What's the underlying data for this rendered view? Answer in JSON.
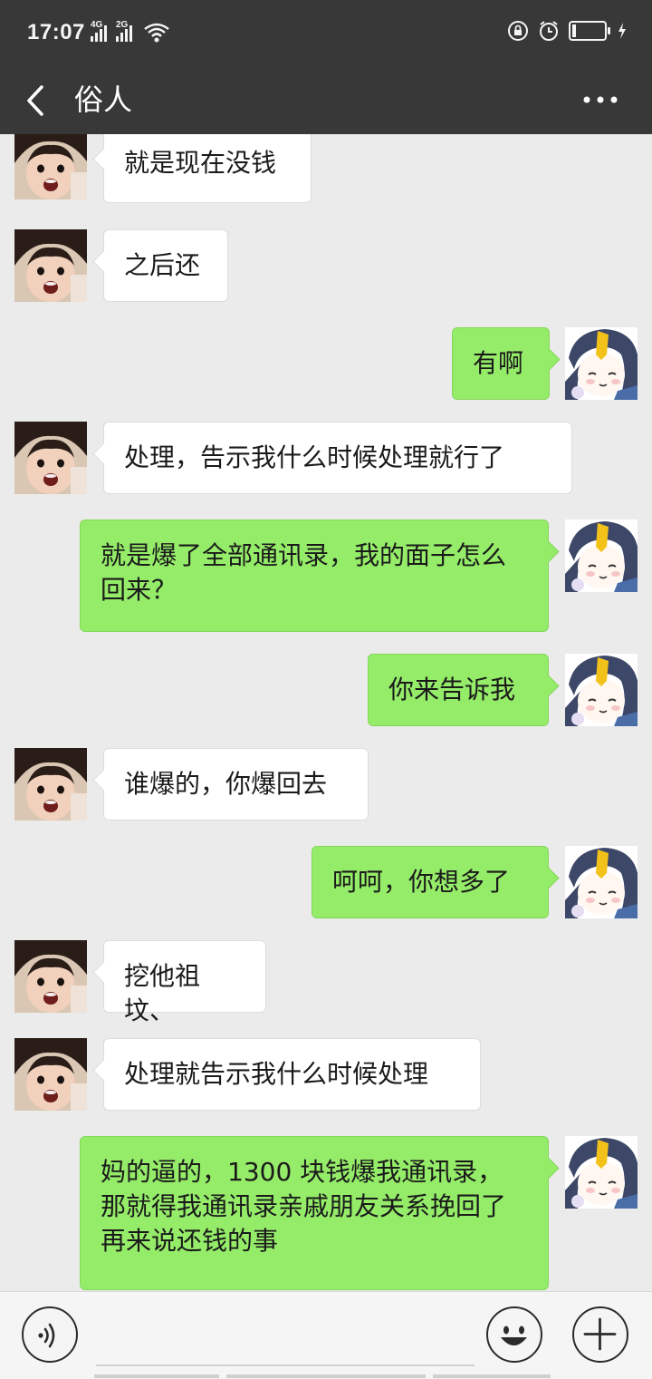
{
  "status_bar": {
    "time": "17:07",
    "net1": "4G",
    "net2": "2G"
  },
  "header": {
    "title": "俗人"
  },
  "messages": [
    {
      "side": "left",
      "text": "就是现在没钱"
    },
    {
      "side": "left",
      "text": "之后还"
    },
    {
      "side": "right",
      "text": "有啊"
    },
    {
      "side": "left",
      "text": "处理，告示我什么时候处理就行了"
    },
    {
      "side": "right",
      "text": "就是爆了全部通讯录，我的面子怎么回来？"
    },
    {
      "side": "right",
      "text": "你来告诉我"
    },
    {
      "side": "left",
      "text": "谁爆的，你爆回去"
    },
    {
      "side": "right",
      "text": "呵呵，你想多了"
    },
    {
      "side": "left",
      "text": "挖他祖坟、"
    },
    {
      "side": "left",
      "text": "处理就告示我什么时候处理"
    },
    {
      "side": "right",
      "text": "妈的逼的，1300 块钱爆我通讯录，那就得我通讯录亲戚朋友关系挽回了再来说还钱的事"
    }
  ],
  "input_bar": {
    "placeholder": ""
  },
  "colors": {
    "header_bg": "#383838",
    "chat_bg": "#ebebeb",
    "sent_bubble": "#95ec69",
    "received_bubble": "#ffffff"
  },
  "icons": {
    "back": "chevron-left-icon",
    "more": "more-dots-icon",
    "voice": "voice-icon",
    "emoji": "emoji-icon",
    "add": "plus-icon"
  }
}
